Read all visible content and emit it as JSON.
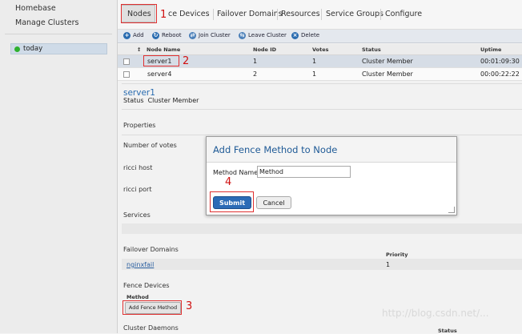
{
  "sidebar": {
    "homebase": "Homebase",
    "manage_clusters": "Manage Clusters",
    "cluster_name": "today",
    "cluster_status_color": "#2fb12f"
  },
  "tabs": [
    "Nodes",
    "ce Devices",
    "Failover Domains",
    "Resources",
    "Service Groups",
    "Configure"
  ],
  "toolbar": {
    "add": "Add",
    "reboot": "Reboot",
    "join": "Join Cluster",
    "leave": "Leave Cluster",
    "delete": "Delete"
  },
  "table": {
    "headers": [
      "Node Name",
      "Node ID",
      "Votes",
      "Status",
      "Uptime"
    ],
    "sort_mark": "↕",
    "rows": [
      {
        "name": "server1",
        "id": "1",
        "votes": "1",
        "status": "Cluster Member",
        "uptime": "00:01:09:30"
      },
      {
        "name": "server4",
        "id": "2",
        "votes": "1",
        "status": "Cluster Member",
        "uptime": "00:00:22:22"
      }
    ]
  },
  "detail": {
    "title": "server1",
    "status_label": "Status",
    "status_value": "Cluster Member",
    "properties": "Properties",
    "votes_label": "Number of votes",
    "ricci_host": "ricci host",
    "ricci_port": "ricci port",
    "services": "Services",
    "failover_domains": "Failover Domains",
    "priority": "Priority",
    "fd_name": "nginxfail",
    "fd_priority": "1",
    "fence_devices": "Fence Devices",
    "method": "Method",
    "add_fence_method": "Add Fence Method",
    "cluster_daemons": "Cluster Daemons",
    "status_col": "Status"
  },
  "dialog": {
    "title": "Add Fence Method to Node",
    "label": "Method Name:",
    "value": "Method",
    "submit": "Submit",
    "cancel": "Cancel"
  },
  "annotations": {
    "n1": "1",
    "n2": "2",
    "n3": "3",
    "n4": "4"
  },
  "watermark": "http://blog.csdn.net/..."
}
